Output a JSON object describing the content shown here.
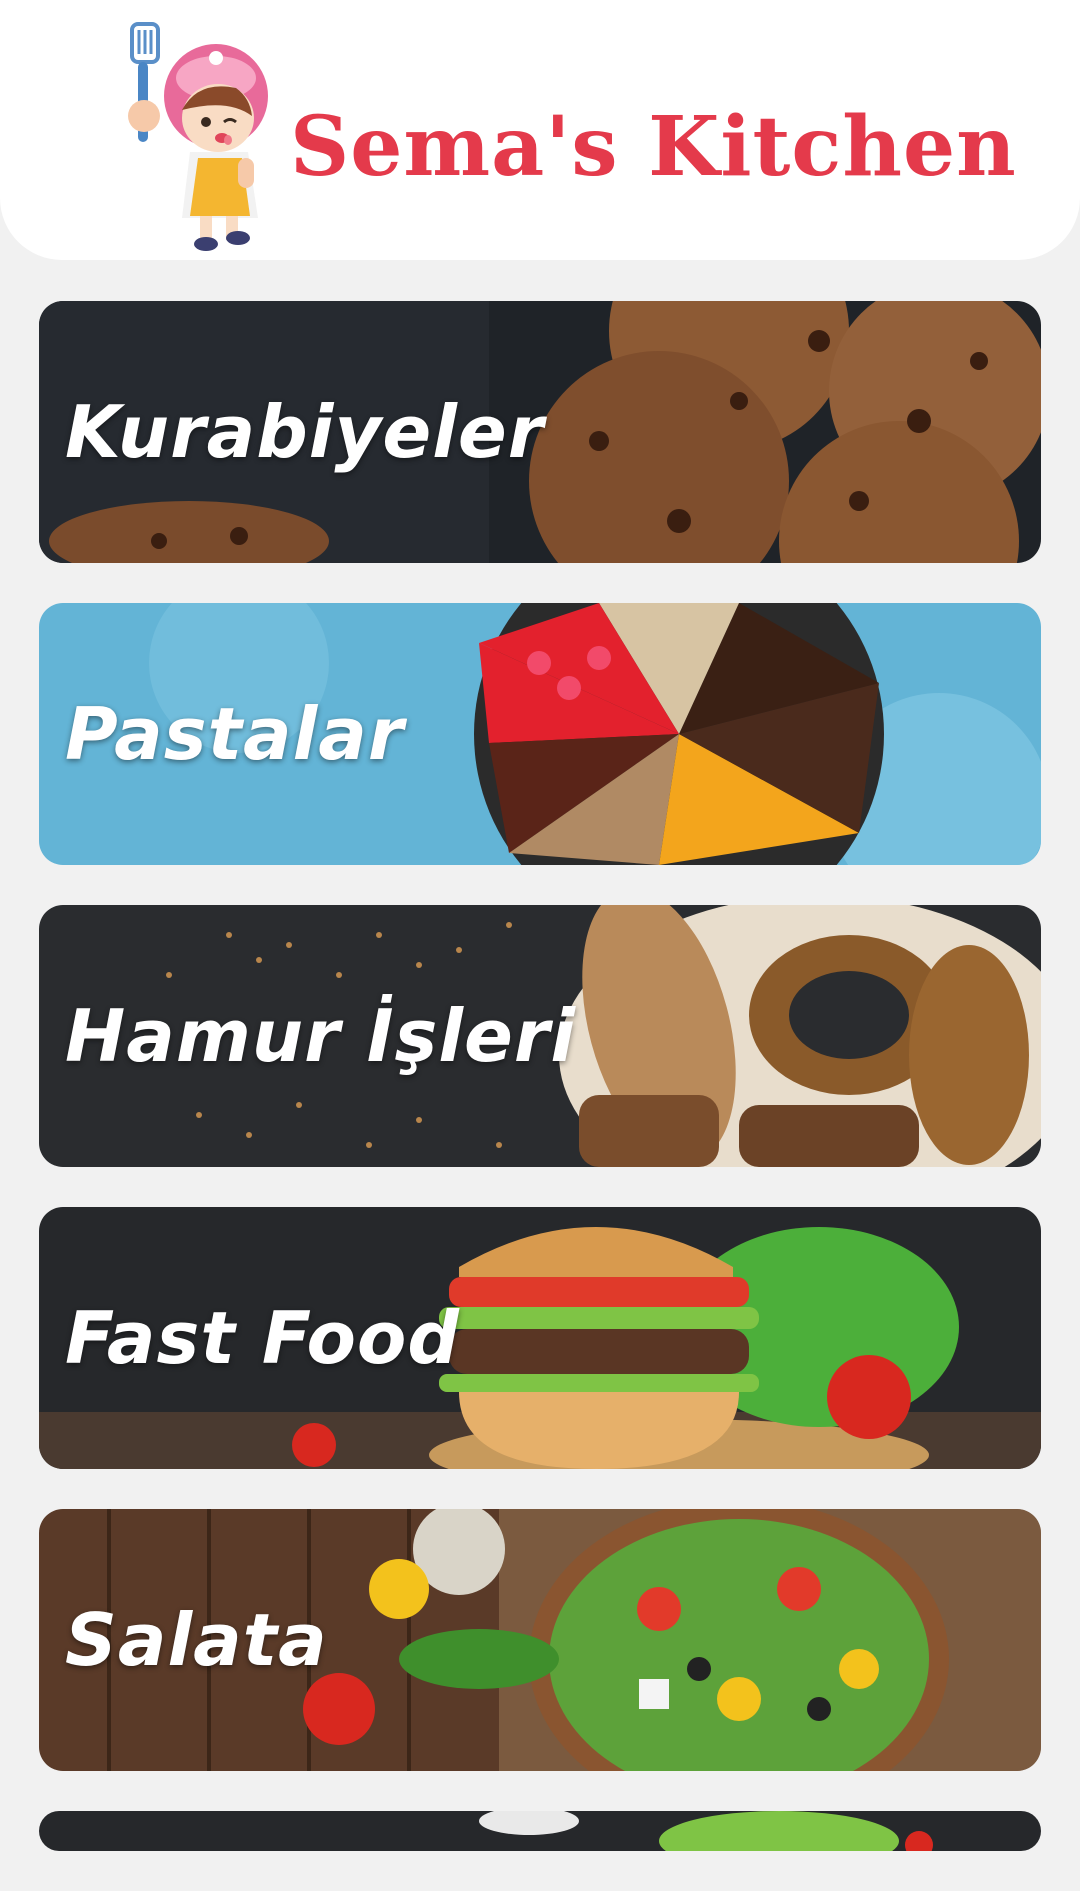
{
  "header": {
    "title": "Sema's Kitchen",
    "logo_icon": "chef-girl-mascot-icon",
    "brand_color": "#e43a4b"
  },
  "categories": [
    {
      "label": "Kurabiyeler",
      "image": "cookies-photo"
    },
    {
      "label": "Pastalar",
      "image": "cake-slices-photo"
    },
    {
      "label": "Hamur İşleri",
      "image": "bread-photo"
    },
    {
      "label": "Fast Food",
      "image": "burger-photo"
    },
    {
      "label": "Salata",
      "image": "salad-photo"
    }
  ]
}
